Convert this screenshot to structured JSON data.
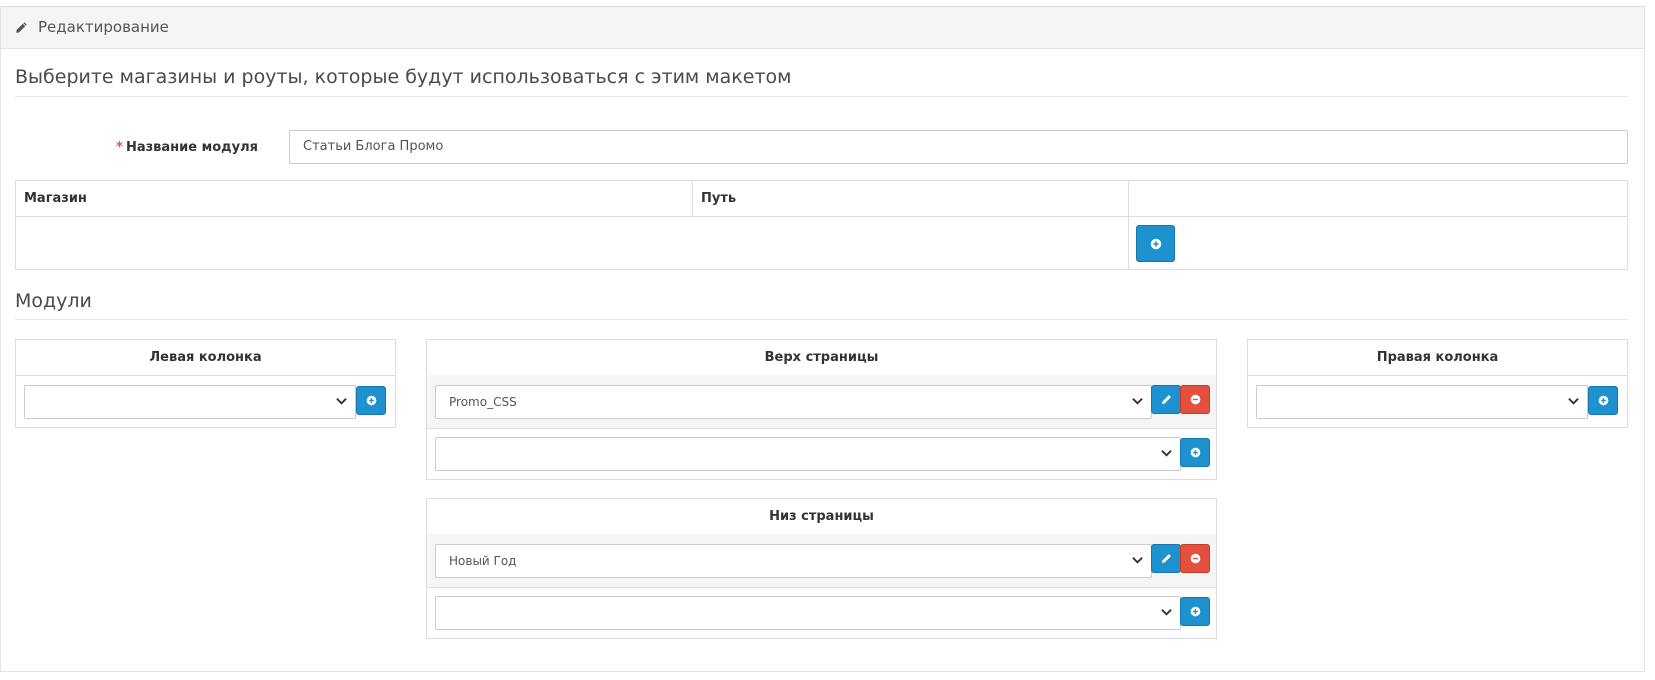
{
  "panel": {
    "heading_title": "Редактирование",
    "icon": "pencil-icon"
  },
  "legend_stores": "Выберите магазины и роуты, которые будут использоваться с этим макетом",
  "form": {
    "required_mark": "*",
    "module_name_label": "Название модуля",
    "module_name_value": "Статьи Блога Промо"
  },
  "routes_table": {
    "headers": [
      "Магазин",
      "Путь",
      ""
    ],
    "add_button_icon": "plus-circle-icon"
  },
  "legend_modules": "Модули",
  "positions": {
    "left": {
      "title": "Левая колонка",
      "selected": ""
    },
    "top": {
      "title": "Верх страницы",
      "assigned": [
        "Promo_CSS"
      ],
      "selected": ""
    },
    "right": {
      "title": "Правая колонка",
      "selected": ""
    },
    "bottom": {
      "title": "Низ страницы",
      "assigned": [
        "Новый Год"
      ],
      "selected": ""
    }
  },
  "colors": {
    "primary": "#1e91cf",
    "danger": "#e3503e",
    "required": "#e3503e"
  }
}
